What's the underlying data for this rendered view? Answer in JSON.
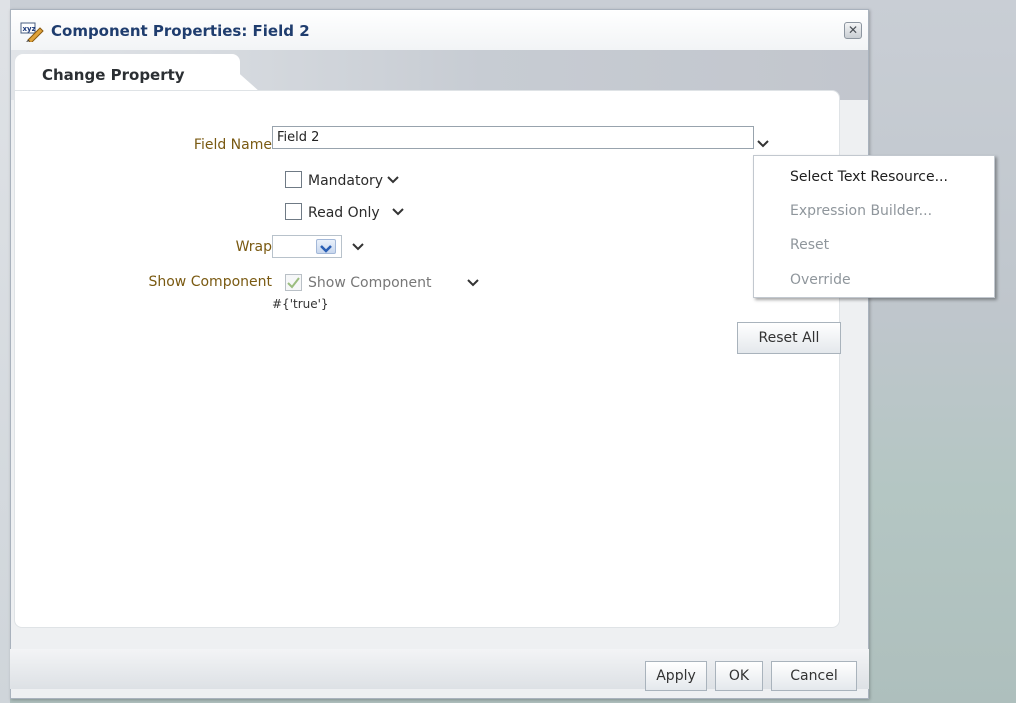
{
  "dialog": {
    "title": "Component Properties: Field 2",
    "tab_label": "Change Property"
  },
  "form": {
    "field_name_label": "Field Name",
    "field_name_value": "Field 2",
    "mandatory_label": "Mandatory",
    "read_only_label": "Read Only",
    "wrap_label": "Wrap",
    "show_component_label": "Show Component",
    "show_component_checkbox_label": "Show Component",
    "show_component_expression": "#{'true'}"
  },
  "buttons": {
    "reset_all": "Reset All",
    "apply": "Apply",
    "ok": "OK",
    "cancel": "Cancel"
  },
  "context_menu": {
    "items": [
      {
        "label": "Select Text Resource...",
        "enabled": true
      },
      {
        "label": "Expression Builder...",
        "enabled": false
      },
      {
        "label": "Reset",
        "enabled": false
      },
      {
        "label": "Override",
        "enabled": false
      }
    ]
  },
  "icons": {
    "title_icon": "properties-edit-icon",
    "close": "close-icon",
    "dropdown": "chevron-down-icon",
    "check": "checkmark-icon"
  },
  "colors": {
    "title": "#1f3d6e",
    "label": "#7a5a12",
    "disabled_text": "#8f969c"
  }
}
